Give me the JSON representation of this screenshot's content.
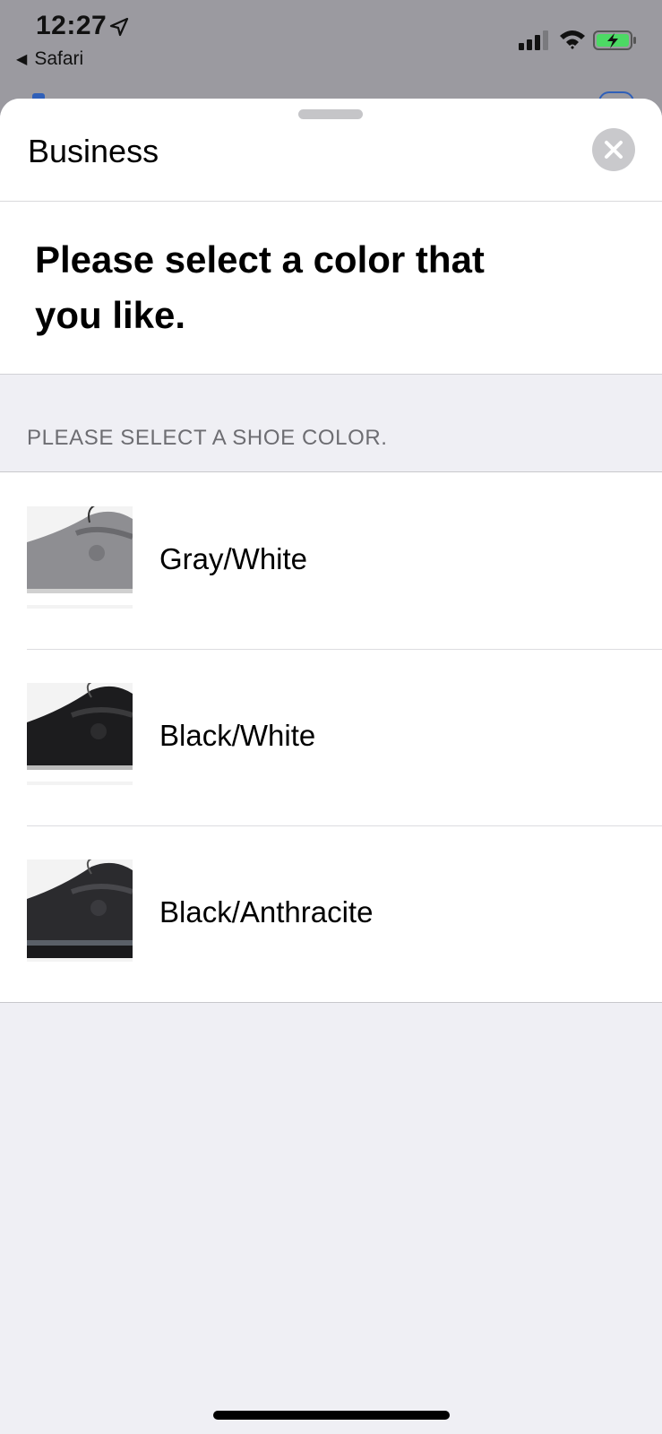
{
  "status_bar": {
    "time": "12:27",
    "back_app": "Safari",
    "icons": [
      "location-arrow-icon",
      "cellular-signal-icon",
      "wifi-icon",
      "battery-charging-icon"
    ],
    "battery_color": "#4cd964"
  },
  "sheet": {
    "title": "Business",
    "close_icon": "close-icon"
  },
  "prompt": {
    "text": "Please select a color that you like."
  },
  "section": {
    "header": "PLEASE SELECT A SHOE COLOR."
  },
  "options": [
    {
      "label": "Gray/White",
      "thumb": "gray-white-shoe-image",
      "color": "#8e8e92"
    },
    {
      "label": "Black/White",
      "thumb": "black-white-shoe-image",
      "color": "#1c1c1e"
    },
    {
      "label": "Black/Anthracite",
      "thumb": "black-anthracite-shoe-image",
      "color": "#2b2b2e"
    }
  ]
}
